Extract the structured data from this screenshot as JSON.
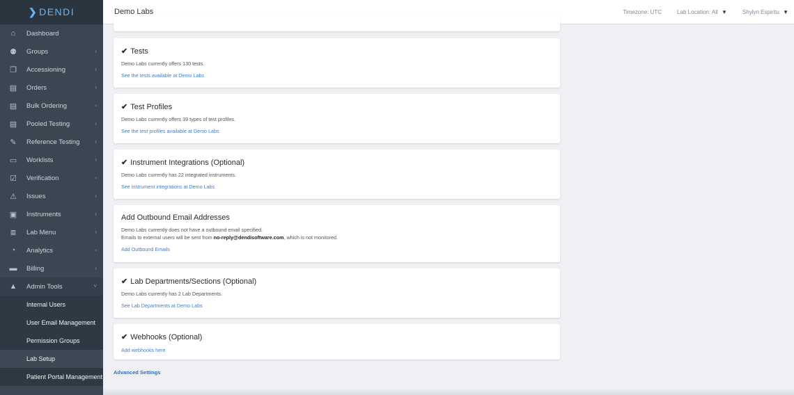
{
  "brand": {
    "name": "DENDI",
    "mark": "❯"
  },
  "header": {
    "title": "Demo Labs",
    "timezone": "Timezone: UTC",
    "lab_location_label": "Lab Location:",
    "lab_location_value": "All",
    "user_name": "Shylyn Espiritu"
  },
  "sidebar": {
    "items": [
      {
        "label": "Dashboard",
        "icon": "home-icon",
        "glyph": "⌂",
        "caret": ""
      },
      {
        "label": "Groups",
        "icon": "users-icon",
        "glyph": "⚉",
        "caret": "‹"
      },
      {
        "label": "Accessioning",
        "icon": "accession-icon",
        "glyph": "❐",
        "caret": "‹"
      },
      {
        "label": "Orders",
        "icon": "orders-icon",
        "glyph": "▤",
        "caret": "‹"
      },
      {
        "label": "Bulk Ordering",
        "icon": "bulk-order-icon",
        "glyph": "▤",
        "caret": "‹"
      },
      {
        "label": "Pooled Testing",
        "icon": "pooled-icon",
        "glyph": "▤",
        "caret": "‹"
      },
      {
        "label": "Reference Testing",
        "icon": "edit-icon",
        "glyph": "✎",
        "caret": "‹"
      },
      {
        "label": "Worklists",
        "icon": "monitor-icon",
        "glyph": "▭",
        "caret": "‹"
      },
      {
        "label": "Verification",
        "icon": "verify-icon",
        "glyph": "☑",
        "caret": "‹"
      },
      {
        "label": "Issues",
        "icon": "warning-icon",
        "glyph": "⚠",
        "caret": "‹"
      },
      {
        "label": "Instruments",
        "icon": "instrument-icon",
        "glyph": "▣",
        "caret": "‹"
      },
      {
        "label": "Lab Menu",
        "icon": "lab-menu-icon",
        "glyph": "≣",
        "caret": "‹"
      },
      {
        "label": "Analytics",
        "icon": "analytics-icon",
        "glyph": "◔",
        "caret": "‹"
      },
      {
        "label": "Billing",
        "icon": "billing-icon",
        "glyph": "▬",
        "caret": "‹"
      },
      {
        "label": "Admin Tools",
        "icon": "lock-icon",
        "glyph": "▲",
        "caret": "˅"
      }
    ],
    "sub_items": [
      {
        "label": "Internal Users"
      },
      {
        "label": "User Email Management"
      },
      {
        "label": "Permission Groups"
      },
      {
        "label": "Lab Setup"
      },
      {
        "label": "Patient Portal Management"
      }
    ]
  },
  "cards": [
    {
      "title": "Tests",
      "checked": true,
      "line1": "Demo Labs currently offers 130 tests.",
      "link": "See the tests available at Demo Labs"
    },
    {
      "title": "Test Profiles",
      "checked": true,
      "line1": "Demo Labs currently offers 39 types of test profiles.",
      "link": "See the test profiles available at Demo Labs"
    },
    {
      "title": "Instrument Integrations (Optional)",
      "checked": true,
      "line1": "Demo Labs currently has 22 integrated instruments.",
      "link": "See instrument integrations at Demo Labs"
    },
    {
      "title": "Add Outbound Email Addresses",
      "checked": false,
      "line1": "Demo Labs currently does not have a outbound email specified.",
      "line2_pre": "Emails to external users will be sent from ",
      "line2_bold": "no-reply@dendisoftware.com",
      "line2_post": ", which is not monitored.",
      "link": "Add Outbound Emails"
    },
    {
      "title": "Lab Departments/Sections (Optional)",
      "checked": true,
      "line1": "Demo Labs currently has 2 Lab Departments.",
      "link": "See Lab Departments at Demo Labs"
    },
    {
      "title": "Webhooks (Optional)",
      "checked": true,
      "line1": "",
      "link": "Add webhooks here"
    }
  ],
  "advanced_settings": "Advanced Settings",
  "check_glyph": "✔",
  "dropdown_glyph": "▼"
}
